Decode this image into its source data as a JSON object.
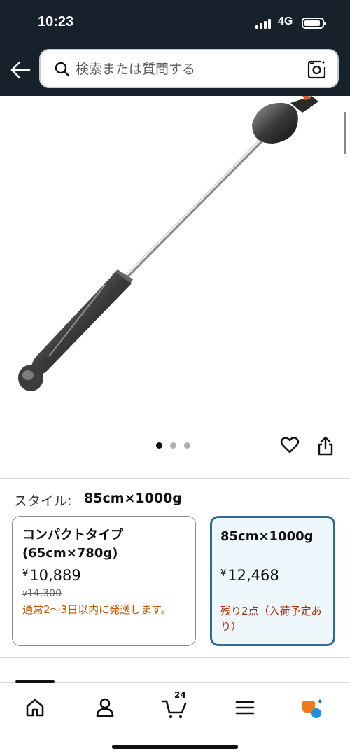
{
  "status": {
    "time": "10:23",
    "network": "4G"
  },
  "search": {
    "placeholder": "検索または質問する"
  },
  "style_selector": {
    "label": "スタイル:",
    "selected": "85cm×1000g"
  },
  "options": [
    {
      "title": "コンパクトタイプ(65cm×780g)",
      "currency": "¥",
      "price": "10,889",
      "old_currency": "¥",
      "old_price": "14,300",
      "shipping": "通常2〜3日以内に発送します。"
    },
    {
      "title": "85cm×1000g",
      "currency": "¥",
      "price": "12,468",
      "stock": "残り2点（入荷予定あり）"
    }
  ],
  "gallery": {
    "count": 3,
    "active_index": 0
  },
  "nav": {
    "cart_count": "24"
  },
  "colors": {
    "header": "#17212c",
    "selected_border": "#2f6c95",
    "shipping": "#c45500",
    "stock": "#b12704"
  }
}
